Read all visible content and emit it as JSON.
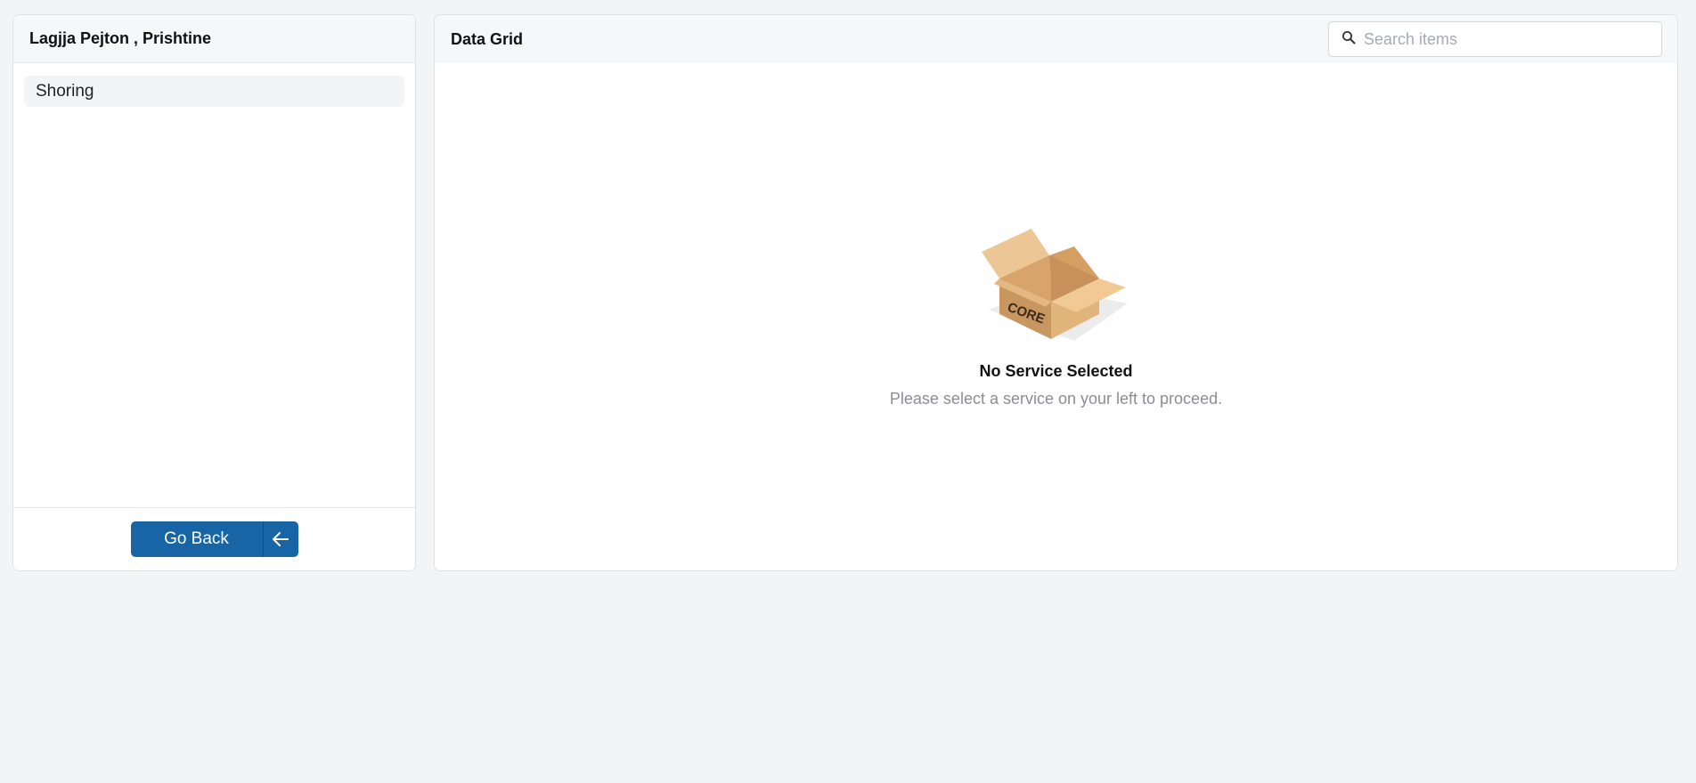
{
  "left_panel": {
    "title": "Lagjja Pejton , Prishtine",
    "items": [
      {
        "label": "Shoring"
      }
    ],
    "footer": {
      "go_back_label": "Go Back",
      "go_back_icon": "arrow-left-icon"
    }
  },
  "right_panel": {
    "title": "Data Grid",
    "search": {
      "placeholder": "Search items",
      "value": "",
      "icon": "search-icon"
    },
    "empty_state": {
      "illustration": "open-box-illustration",
      "box_label": "CORE",
      "title": "No Service Selected",
      "subtitle": "Please select a service on your left to proceed."
    }
  },
  "colors": {
    "background": "#f3f4f6",
    "primary_button": "#1865a6",
    "panel_header": "#f6f7f8"
  }
}
